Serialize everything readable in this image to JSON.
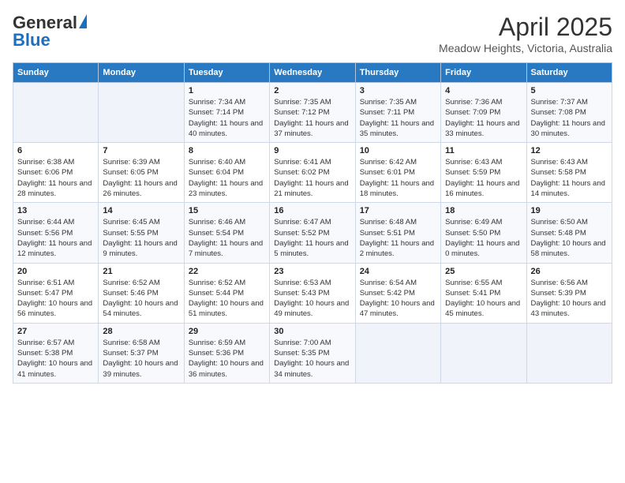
{
  "logo": {
    "general": "General",
    "blue": "Blue"
  },
  "title": "April 2025",
  "subtitle": "Meadow Heights, Victoria, Australia",
  "days_of_week": [
    "Sunday",
    "Monday",
    "Tuesday",
    "Wednesday",
    "Thursday",
    "Friday",
    "Saturday"
  ],
  "weeks": [
    [
      {
        "day": "",
        "info": ""
      },
      {
        "day": "",
        "info": ""
      },
      {
        "day": "1",
        "info": "Sunrise: 7:34 AM\nSunset: 7:14 PM\nDaylight: 11 hours and 40 minutes."
      },
      {
        "day": "2",
        "info": "Sunrise: 7:35 AM\nSunset: 7:12 PM\nDaylight: 11 hours and 37 minutes."
      },
      {
        "day": "3",
        "info": "Sunrise: 7:35 AM\nSunset: 7:11 PM\nDaylight: 11 hours and 35 minutes."
      },
      {
        "day": "4",
        "info": "Sunrise: 7:36 AM\nSunset: 7:09 PM\nDaylight: 11 hours and 33 minutes."
      },
      {
        "day": "5",
        "info": "Sunrise: 7:37 AM\nSunset: 7:08 PM\nDaylight: 11 hours and 30 minutes."
      }
    ],
    [
      {
        "day": "6",
        "info": "Sunrise: 6:38 AM\nSunset: 6:06 PM\nDaylight: 11 hours and 28 minutes."
      },
      {
        "day": "7",
        "info": "Sunrise: 6:39 AM\nSunset: 6:05 PM\nDaylight: 11 hours and 26 minutes."
      },
      {
        "day": "8",
        "info": "Sunrise: 6:40 AM\nSunset: 6:04 PM\nDaylight: 11 hours and 23 minutes."
      },
      {
        "day": "9",
        "info": "Sunrise: 6:41 AM\nSunset: 6:02 PM\nDaylight: 11 hours and 21 minutes."
      },
      {
        "day": "10",
        "info": "Sunrise: 6:42 AM\nSunset: 6:01 PM\nDaylight: 11 hours and 18 minutes."
      },
      {
        "day": "11",
        "info": "Sunrise: 6:43 AM\nSunset: 5:59 PM\nDaylight: 11 hours and 16 minutes."
      },
      {
        "day": "12",
        "info": "Sunrise: 6:43 AM\nSunset: 5:58 PM\nDaylight: 11 hours and 14 minutes."
      }
    ],
    [
      {
        "day": "13",
        "info": "Sunrise: 6:44 AM\nSunset: 5:56 PM\nDaylight: 11 hours and 12 minutes."
      },
      {
        "day": "14",
        "info": "Sunrise: 6:45 AM\nSunset: 5:55 PM\nDaylight: 11 hours and 9 minutes."
      },
      {
        "day": "15",
        "info": "Sunrise: 6:46 AM\nSunset: 5:54 PM\nDaylight: 11 hours and 7 minutes."
      },
      {
        "day": "16",
        "info": "Sunrise: 6:47 AM\nSunset: 5:52 PM\nDaylight: 11 hours and 5 minutes."
      },
      {
        "day": "17",
        "info": "Sunrise: 6:48 AM\nSunset: 5:51 PM\nDaylight: 11 hours and 2 minutes."
      },
      {
        "day": "18",
        "info": "Sunrise: 6:49 AM\nSunset: 5:50 PM\nDaylight: 11 hours and 0 minutes."
      },
      {
        "day": "19",
        "info": "Sunrise: 6:50 AM\nSunset: 5:48 PM\nDaylight: 10 hours and 58 minutes."
      }
    ],
    [
      {
        "day": "20",
        "info": "Sunrise: 6:51 AM\nSunset: 5:47 PM\nDaylight: 10 hours and 56 minutes."
      },
      {
        "day": "21",
        "info": "Sunrise: 6:52 AM\nSunset: 5:46 PM\nDaylight: 10 hours and 54 minutes."
      },
      {
        "day": "22",
        "info": "Sunrise: 6:52 AM\nSunset: 5:44 PM\nDaylight: 10 hours and 51 minutes."
      },
      {
        "day": "23",
        "info": "Sunrise: 6:53 AM\nSunset: 5:43 PM\nDaylight: 10 hours and 49 minutes."
      },
      {
        "day": "24",
        "info": "Sunrise: 6:54 AM\nSunset: 5:42 PM\nDaylight: 10 hours and 47 minutes."
      },
      {
        "day": "25",
        "info": "Sunrise: 6:55 AM\nSunset: 5:41 PM\nDaylight: 10 hours and 45 minutes."
      },
      {
        "day": "26",
        "info": "Sunrise: 6:56 AM\nSunset: 5:39 PM\nDaylight: 10 hours and 43 minutes."
      }
    ],
    [
      {
        "day": "27",
        "info": "Sunrise: 6:57 AM\nSunset: 5:38 PM\nDaylight: 10 hours and 41 minutes."
      },
      {
        "day": "28",
        "info": "Sunrise: 6:58 AM\nSunset: 5:37 PM\nDaylight: 10 hours and 39 minutes."
      },
      {
        "day": "29",
        "info": "Sunrise: 6:59 AM\nSunset: 5:36 PM\nDaylight: 10 hours and 36 minutes."
      },
      {
        "day": "30",
        "info": "Sunrise: 7:00 AM\nSunset: 5:35 PM\nDaylight: 10 hours and 34 minutes."
      },
      {
        "day": "",
        "info": ""
      },
      {
        "day": "",
        "info": ""
      },
      {
        "day": "",
        "info": ""
      }
    ]
  ]
}
